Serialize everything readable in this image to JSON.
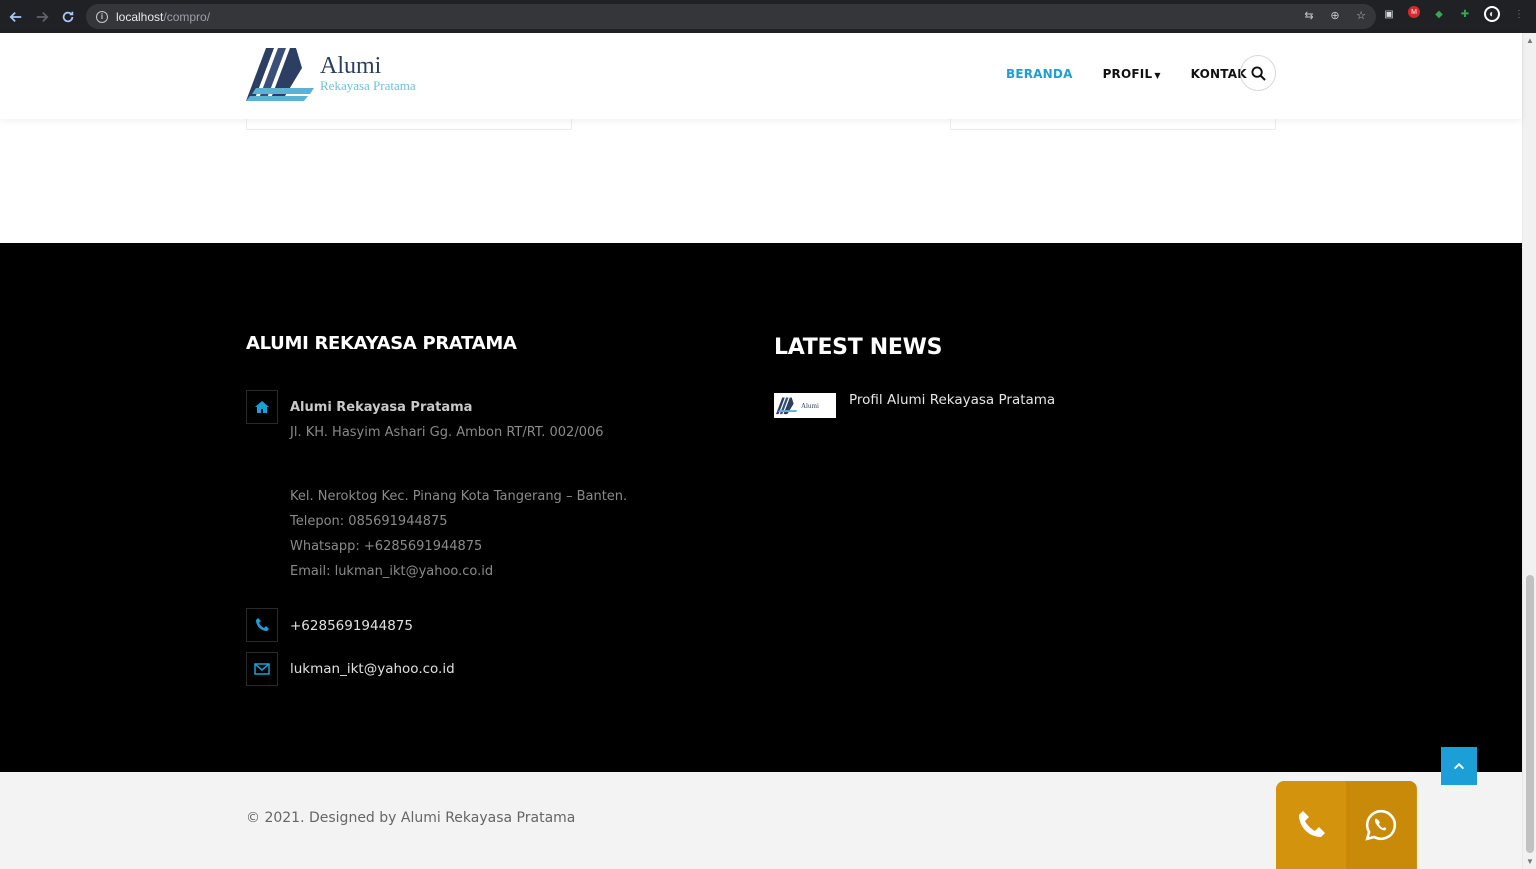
{
  "browser": {
    "url_host": "localhost",
    "url_path": "/compro/"
  },
  "header": {
    "logo": {
      "name": "Alumi",
      "sub": "Rekayasa Pratama"
    },
    "menu": [
      {
        "label": "BERANDA",
        "active": true
      },
      {
        "label": "PROFIL",
        "active": false,
        "dropdown": true
      },
      {
        "label": "KONTAK",
        "active": false
      }
    ]
  },
  "footer": {
    "company_title": "ALUMI REKAYASA PRATAMA",
    "address": {
      "name": "Alumi Rekayasa Pratama",
      "line1": "Jl. KH. Hasyim Ashari Gg. Ambon RT/RT. 002/006",
      "line2": "Kel. Neroktog Kec. Pinang Kota Tangerang – Banten.",
      "phone": "Telepon: 085691944875",
      "whatsapp": "Whatsapp: +6285691944875",
      "email": "Email: lukman_ikt@yahoo.co.id"
    },
    "phone": "+6285691944875",
    "email": "lukman_ikt@yahoo.co.id",
    "news_title": "LATEST NEWS",
    "news": [
      {
        "title": "Profil Alumi Rekayasa Pratama",
        "thumb_text": "Alumi"
      }
    ]
  },
  "copyright": "© 2021. Designed by Alumi Rekayasa Pratama",
  "colors": {
    "accent": "#1b9fd6",
    "footer_bg": "#000000",
    "contact_button": "#d4930d"
  }
}
